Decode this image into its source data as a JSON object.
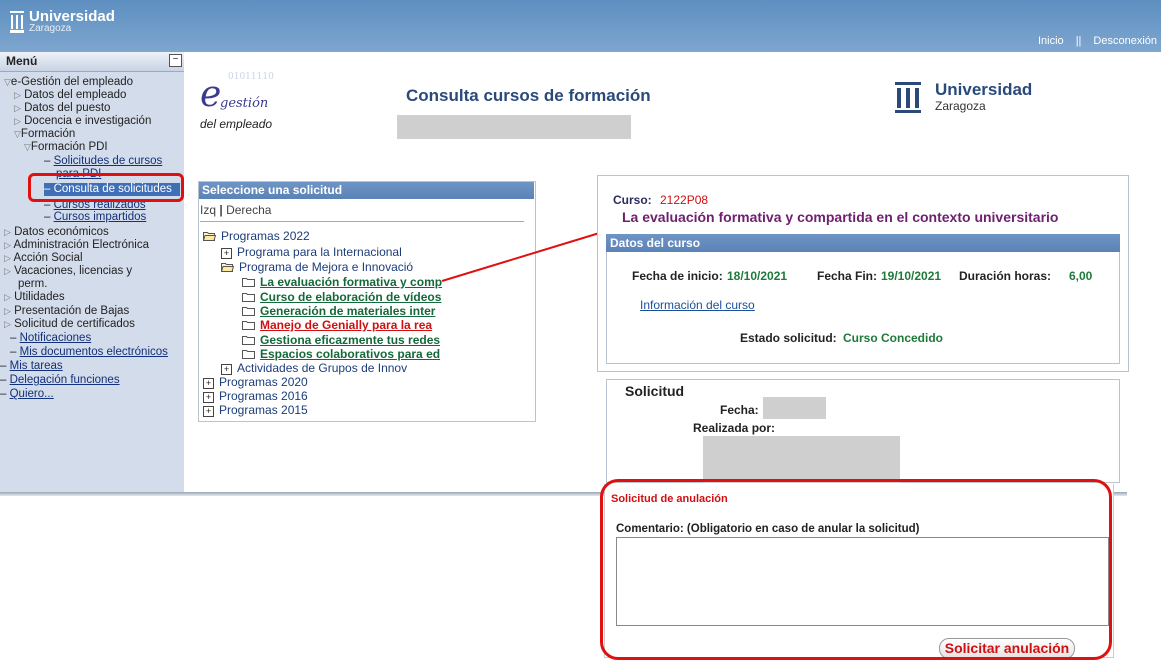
{
  "header": {
    "logo_name": "Universidad",
    "logo_sub": "Zaragoza",
    "nav": [
      "Inicio",
      "||",
      "Desconexión"
    ]
  },
  "menu": {
    "title": "Menú",
    "collapse_symbol": "−",
    "items": [
      {
        "label": "e-Gestión del empleado",
        "marker": "▽"
      },
      {
        "label": "Datos del empleado",
        "marker": "▷"
      },
      {
        "label": "Datos del puesto",
        "marker": "▷"
      },
      {
        "label": "Docencia e investigación",
        "marker": "▷"
      },
      {
        "label": "Formación",
        "marker": "▽"
      },
      {
        "label": "Formación PDI",
        "marker": "▽"
      },
      {
        "label": "Solicitudes de cursos",
        "marker": "–"
      },
      {
        "label": "para PDI",
        "marker": ""
      },
      {
        "label": "Consulta de solicitudes",
        "marker": "–"
      },
      {
        "label": "Cursos realizados",
        "marker": "–"
      },
      {
        "label": "Cursos impartidos",
        "marker": "–"
      },
      {
        "label": "Datos económicos",
        "marker": "▷"
      },
      {
        "label": "Administración Electrónica",
        "marker": "▷"
      },
      {
        "label": "Acción Social",
        "marker": "▷"
      },
      {
        "label": "Vacaciones, licencias y",
        "marker": "▷"
      },
      {
        "label": "perm.",
        "marker": ""
      },
      {
        "label": "Utilidades",
        "marker": "▷"
      },
      {
        "label": "Presentación de Bajas",
        "marker": "▷"
      },
      {
        "label": "Solicitud de certificados",
        "marker": "▷"
      },
      {
        "label": "Notificaciones",
        "marker": "–"
      },
      {
        "label": "Mis documentos electrónicos",
        "marker": "–"
      },
      {
        "label": "Mis tareas",
        "marker": "–"
      },
      {
        "label": "Delegación funciones",
        "marker": "–"
      },
      {
        "label": "Quiero...",
        "marker": "–"
      }
    ]
  },
  "egestion_logo": {
    "letter": "e",
    "word": "gestión",
    "sub": "del empleado",
    "digits": "01011110"
  },
  "page_title": "Consulta cursos de formación",
  "uz_logo": {
    "name": "Universidad",
    "sub": "Zaragoza"
  },
  "tree": {
    "header": "Seleccione una solicitud",
    "toggle_left": "Izq",
    "toggle_sep": "|",
    "toggle_right": "Derecha",
    "nodes": [
      {
        "label": "Programas 2022"
      },
      {
        "label": "Programa para la Internacional"
      },
      {
        "label": "Programa de Mejora e Innovació"
      },
      {
        "label": "La evaluación formativa y comp"
      },
      {
        "label": "Curso de elaboración de vídeos"
      },
      {
        "label": "Generación de materiales inter"
      },
      {
        "label": "Manejo de Genially para la rea"
      },
      {
        "label": "Gestiona eficazmente tus redes"
      },
      {
        "label": "Espacios colaborativos para ed"
      },
      {
        "label": "Actividades de Grupos de Innov"
      },
      {
        "label": "Programas 2020"
      },
      {
        "label": "Programas 2016"
      },
      {
        "label": "Programas 2015"
      }
    ]
  },
  "course": {
    "curso_label": "Curso:",
    "curso_code": "2122P08",
    "title": "La evaluación formativa y compartida en el contexto universitario",
    "datos_header": "Datos del curso",
    "fecha_inicio_label": "Fecha de inicio:",
    "fecha_inicio": "18/10/2021",
    "fecha_fin_label": "Fecha Fin:",
    "fecha_fin": "19/10/2021",
    "duracion_label": "Duración horas:",
    "duracion": "6,00",
    "info_link": "Información del curso",
    "estado_label": "Estado solicitud:",
    "estado": "Curso Concedido"
  },
  "solicitud": {
    "title": "Solicitud",
    "fecha_label": "Fecha:",
    "realizada_label": "Realizada por:"
  },
  "anulacion": {
    "title": "Solicitud de anulación",
    "comment_label": "Comentario: (Obligatorio en caso de anular la solicitud)",
    "comment_value": "",
    "button": "Solicitar anulación"
  },
  "colors": {
    "header_blue": "#6b9ac9",
    "menu_bg": "#d3dcea",
    "highlight_red": "#e01010",
    "value_green": "#1f7a3a",
    "title_purple": "#6e1f6e"
  }
}
